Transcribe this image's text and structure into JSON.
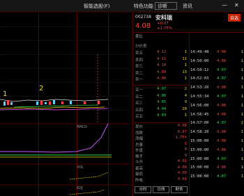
{
  "topbar": {
    "left_title": "智能选股(F)",
    "center_left": "特色功能",
    "center_search": "诊断",
    "center_right": "资讯",
    "right_icons": [
      "—",
      "✕"
    ]
  },
  "chart": {
    "markers": [
      "1",
      "2"
    ],
    "indicator_title": "MACD",
    "sub_title_1": "VOL",
    "sub_title_2": "KDJ"
  },
  "quote": {
    "code": "002738",
    "name": "安科瑞",
    "tag_label": "自选",
    "price": "4.08",
    "change": "+0.07",
    "change_pct": "+1.75%",
    "section_commission": "委比",
    "section_depth": "分价表",
    "bid_ask_top": [
      {
        "label": "卖五",
        "price": "4.12",
        "vol": "1"
      },
      {
        "label": "卖四",
        "price": "4.11",
        "vol": "11"
      },
      {
        "label": "卖三",
        "price": "4.10",
        "vol": "1"
      },
      {
        "label": "卖二",
        "price": "4.09",
        "vol": "13"
      },
      {
        "label": "卖一",
        "price": "4.08",
        "vol": "1"
      }
    ],
    "bid_ask_bottom": [
      {
        "label": "买一",
        "price": "4.07",
        "vol": "2"
      },
      {
        "label": "买二",
        "price": "4.06",
        "vol": "4"
      },
      {
        "label": "买三",
        "price": "4.05",
        "vol": "9"
      },
      {
        "label": "买四",
        "price": "4.04",
        "vol": "20"
      },
      {
        "label": "买五",
        "price": "4.03",
        "vol": "1"
      }
    ],
    "stats": [
      {
        "label": "现价",
        "value": "4.08"
      },
      {
        "label": "涨跌",
        "value": "0.07"
      },
      {
        "label": "涨幅",
        "value": "1.75%"
      },
      {
        "label": "总量",
        "value": "1"
      },
      {
        "label": "外盘",
        "value": "0"
      },
      {
        "label": "换手",
        "value": "0"
      },
      {
        "label": "今开",
        "value": "4.01"
      },
      {
        "label": "最高",
        "value": "4.08"
      },
      {
        "label": "最低",
        "value": "4.00"
      },
      {
        "label": "昨收",
        "value": "4.01"
      }
    ],
    "trades": [
      {
        "time": "14:49:48",
        "price": "4.08",
        "vol": "1"
      },
      {
        "time": "14:50:00",
        "price": "4.08",
        "vol": "1"
      },
      {
        "time": "14:50:12",
        "price": "4.07",
        "vol": "1"
      },
      {
        "time": "14:52:03",
        "price": "4.07",
        "vol": "1"
      },
      {
        "time": "14:53:20",
        "price": "4.08",
        "vol": "1"
      },
      {
        "time": "14:55:34",
        "price": "4.07",
        "vol": "1"
      },
      {
        "time": "14:56:08",
        "price": "4.08",
        "vol": "1"
      },
      {
        "time": "14:56:45",
        "price": "4.08",
        "vol": "1"
      },
      {
        "time": "14:57:00",
        "price": "4.07",
        "vol": "2"
      },
      {
        "time": "14:58:20",
        "price": "4.08",
        "vol": "1"
      },
      {
        "time": "15:00:00",
        "price": "4.08",
        "vol": "1"
      },
      {
        "time": "15:00:00",
        "price": "4.08",
        "vol": "1"
      },
      {
        "time": "15:00:00",
        "price": "4.07",
        "vol": "1"
      },
      {
        "time": "15:00:00",
        "price": "4.08",
        "vol": "1"
      },
      {
        "time": "15:00:00",
        "price": "4.07",
        "vol": "1"
      }
    ],
    "bottom_tabs": [
      "分时",
      "日线",
      "财务"
    ]
  }
}
